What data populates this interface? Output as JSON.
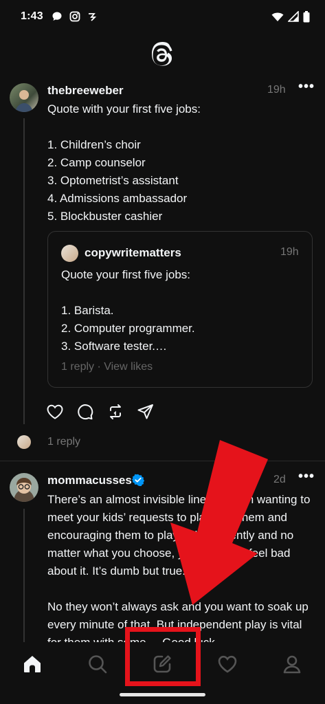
{
  "status_bar": {
    "time": "1:43",
    "icons_left": [
      "chat-bubble-icon",
      "instagram-icon",
      "threads-notif-icon"
    ],
    "icons_right": [
      "wifi-icon",
      "signal-icon",
      "battery-icon"
    ]
  },
  "header": {
    "logo": "threads-logo-icon"
  },
  "post1": {
    "username": "thebreeweber",
    "timestamp": "19h",
    "text": "Quote with your first five jobs:\n\n1. Children’s choir\n2. Camp counselor\n3. Optometrist’s assistant\n4. Admissions ambassador\n5. Blockbuster cashier",
    "quote": {
      "username": "copywritematters",
      "timestamp": "19h",
      "text": "Quote your first five jobs:\n\n1. Barista.\n2. Computer programmer.\n3. Software tester.…",
      "meta": "1 reply · View likes"
    },
    "actions": [
      "heart-icon",
      "comment-icon",
      "repost-icon",
      "share-icon"
    ],
    "replies": "1 reply"
  },
  "post2": {
    "username": "mommacusses",
    "verified": true,
    "timestamp": "2d",
    "text": "There’s an almost invisible line between wanting to\nmeet your kids’ requests to play with them and\nencouraging them to play independently and no\nmatter what you choose, you’re gonna feel bad\nabout it. It’s dumb but true.\n\nNo they won’t always ask and you want to soak up\nevery minute of that. But independent play is vital\nfor them with some ... Good luck"
  },
  "bottom_nav": {
    "items": [
      "home-icon",
      "search-icon",
      "compose-icon",
      "activity-heart-icon",
      "profile-icon"
    ],
    "active": "home-icon"
  },
  "colors": {
    "background": "#101010",
    "text": "#f3f5f7",
    "muted": "#777777",
    "annotation_red": "#e5131b",
    "verified_blue": "#0095f6"
  }
}
